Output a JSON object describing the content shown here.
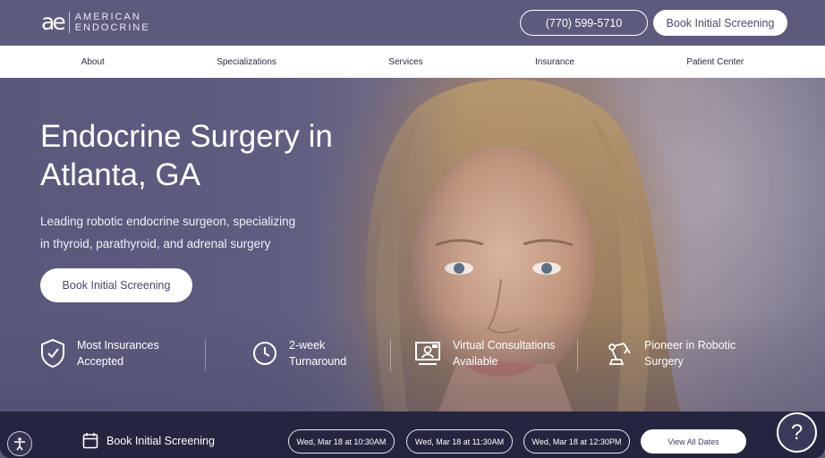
{
  "header": {
    "logo_mark": "ae",
    "logo_line1": "AMERICAN",
    "logo_line2": "ENDOCRINE",
    "phone": "(770) 599-5710",
    "cta": "Book Initial Screening"
  },
  "nav": {
    "items": [
      {
        "label": "About"
      },
      {
        "label": "Specializations"
      },
      {
        "label": "Services"
      },
      {
        "label": "Insurance"
      },
      {
        "label": "Patient Center"
      }
    ]
  },
  "hero": {
    "title_line1": "Endocrine Surgery in",
    "title_line2": "Atlanta, GA",
    "sub_line1": "Leading robotic endocrine surgeon, specializing",
    "sub_line2": "in thyroid, parathyroid, and adrenal surgery",
    "button": "Book Initial Screening"
  },
  "features": [
    {
      "icon": "shield-check-icon",
      "line1": "Most Insurances",
      "line2": "Accepted"
    },
    {
      "icon": "clock-icon",
      "line1": "2-week",
      "line2": "Turnaround"
    },
    {
      "icon": "video-consultation-icon",
      "line1": "Virtual Consultations",
      "line2": "Available"
    },
    {
      "icon": "robotic-arm-icon",
      "line1": "Pioneer in Robotic",
      "line2": "Surgery"
    }
  ],
  "booking_bar": {
    "label": "Book Initial Screening",
    "dates": [
      "Wed, Mar 18 at 10:30AM",
      "Wed, Mar 18 at 11:30AM",
      "Wed, Mar 18 at 12:30PM"
    ],
    "view_all": "View All Dates"
  },
  "help": "?",
  "colors": {
    "brand": "#5d5b7d",
    "bar": "#262540"
  }
}
